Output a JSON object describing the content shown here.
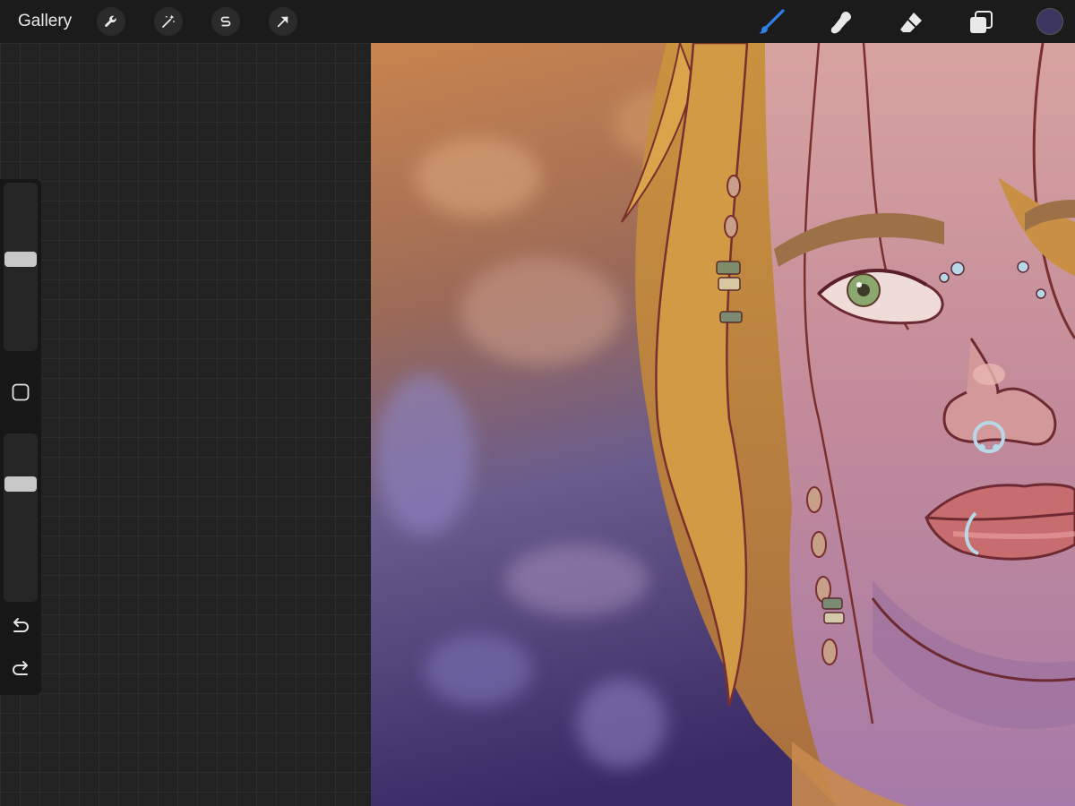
{
  "toolbar": {
    "gallery_label": "Gallery",
    "left_tools": [
      "wrench-icon",
      "magic-wand-icon",
      "selection-s-icon",
      "transform-arrow-icon"
    ],
    "right_tools": [
      "brush-icon",
      "smudge-icon",
      "eraser-icon",
      "layers-icon"
    ],
    "active_tool": "brush",
    "current_color": "#3c3560",
    "active_color": "#2f7fe8"
  },
  "sidebar": {
    "brush_size_level": 0.55,
    "opacity_level": 0.72,
    "modify_icon": "square-modify-icon",
    "undo_icon": "undo-arrow-icon",
    "redo_icon": "redo-arrow-icon"
  },
  "canvas": {
    "subject": "digital-painting-portrait"
  }
}
